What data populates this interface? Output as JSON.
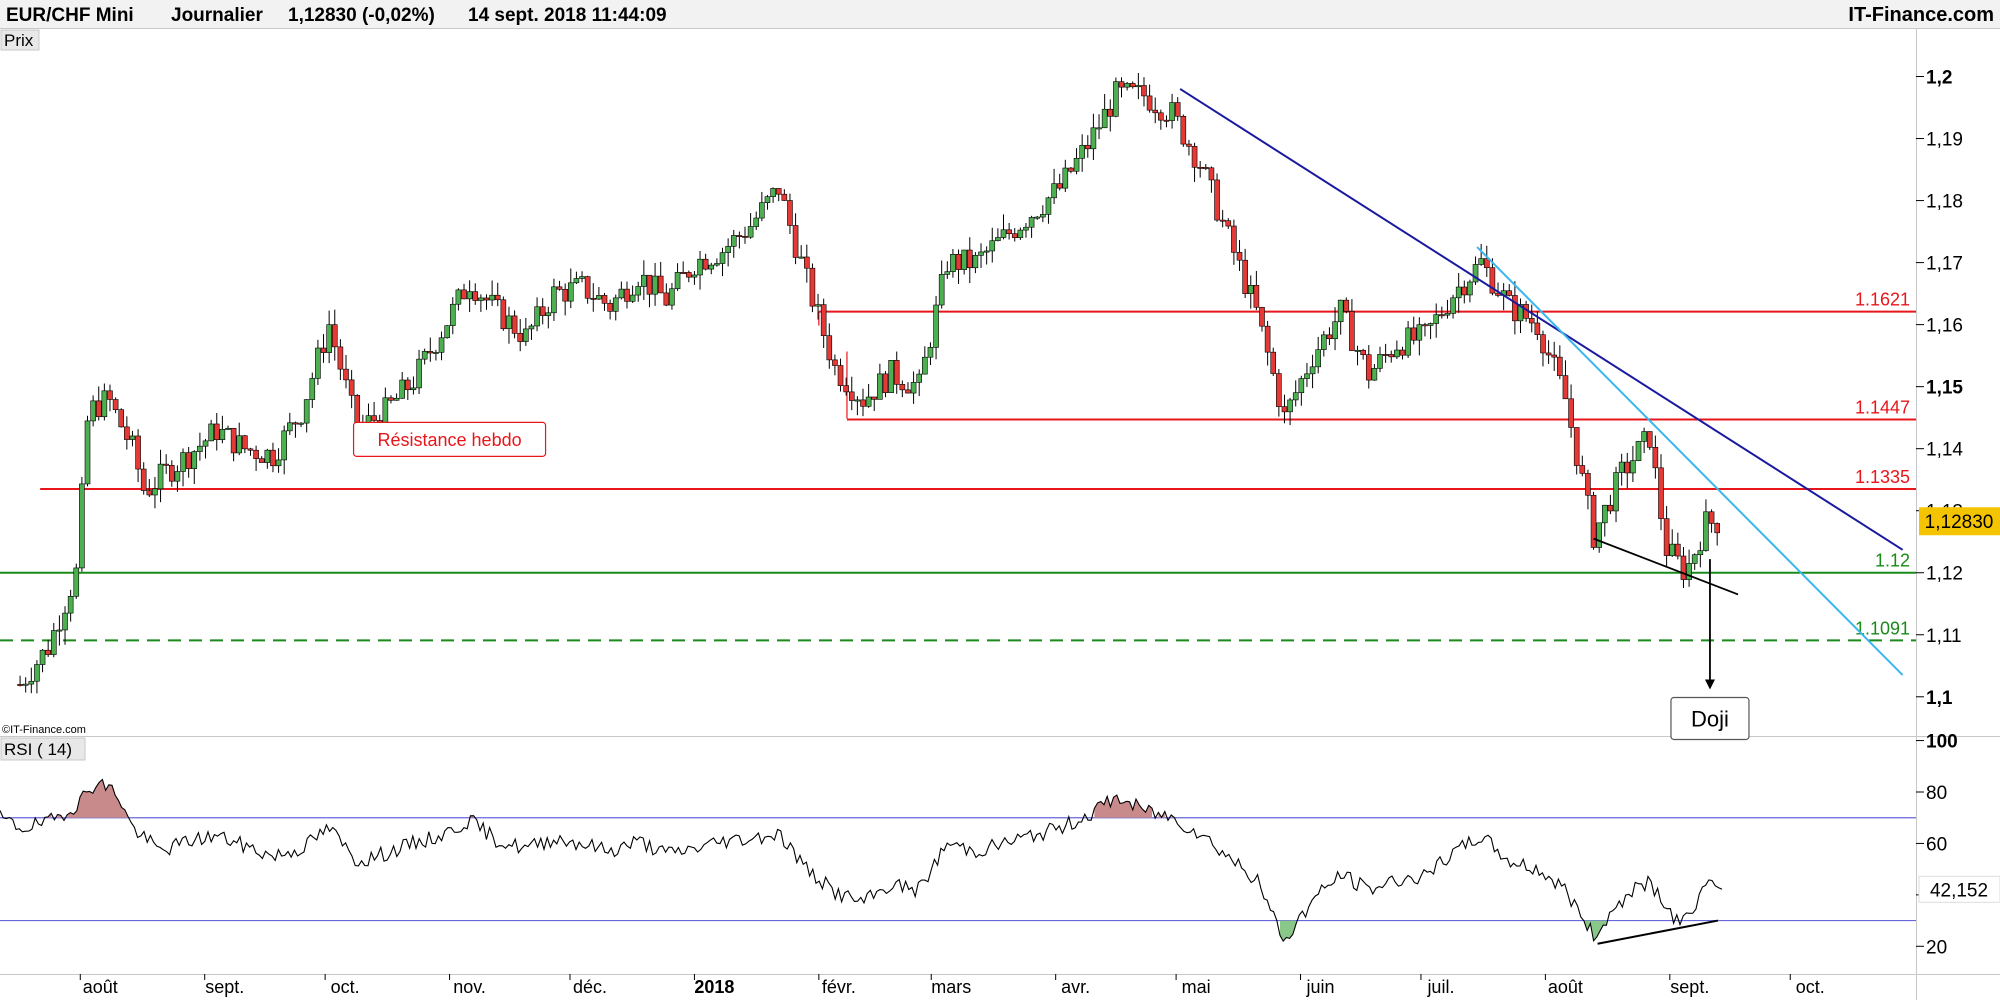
{
  "header": {
    "symbol": "EUR/CHF Mini",
    "period": "Journalier",
    "price_info": "1,12830 (-0,02%)",
    "datetime": "14 sept. 2018 11:44:09",
    "brand": "IT-Finance.com"
  },
  "price_panel_label": "Prix",
  "copyright": "©IT-Finance.com",
  "rsi_panel_label": "RSI ( 14)",
  "colors": {
    "up_candle": "#4caf50",
    "down_candle": "#e53935",
    "resistance": "#e8161b",
    "support": "#1a8a1a",
    "trend_dark": "#1a1a9e",
    "trend_light": "#3ab7ee",
    "current_price_bg": "#f5c400",
    "rsi_band": "#6666dd",
    "rsi_overbought_fill": "#c88a8a",
    "rsi_oversold_fill": "#8ac88a"
  },
  "chart_data": [
    {
      "type": "candlestick",
      "title": "EUR/CHF Mini",
      "x_labels": [
        "août",
        "sept.",
        "oct.",
        "nov.",
        "déc.",
        "2018",
        "févr.",
        "mars",
        "avr.",
        "mai",
        "juin",
        "juil.",
        "août",
        "sept.",
        "oct."
      ],
      "y_ticks": [
        "1,1",
        "1,11",
        "1,12",
        "1,13",
        "1,14",
        "1,15",
        "1,16",
        "1,17",
        "1,18",
        "1,19",
        "1,2"
      ],
      "y_range": [
        1.094,
        1.2075
      ],
      "current_price": "1,12830",
      "close_path": [
        [
          "2017-07-17",
          1.102
        ],
        [
          "2017-07-24",
          1.108
        ],
        [
          "2017-07-31",
          1.12
        ],
        [
          "2017-08-03",
          1.146
        ],
        [
          "2017-08-08",
          1.148
        ],
        [
          "2017-08-14",
          1.14
        ],
        [
          "2017-08-17",
          1.133
        ],
        [
          "2017-08-22",
          1.136
        ],
        [
          "2017-08-28",
          1.139
        ],
        [
          "2017-09-04",
          1.143
        ],
        [
          "2017-09-11",
          1.14
        ],
        [
          "2017-09-18",
          1.139
        ],
        [
          "2017-09-25",
          1.146
        ],
        [
          "2017-10-02",
          1.16
        ],
        [
          "2017-10-09",
          1.143
        ],
        [
          "2017-10-16",
          1.146
        ],
        [
          "2017-10-23",
          1.151
        ],
        [
          "2017-10-30",
          1.159
        ],
        [
          "2017-11-06",
          1.167
        ],
        [
          "2017-11-13",
          1.162
        ],
        [
          "2017-11-20",
          1.158
        ],
        [
          "2017-11-27",
          1.165
        ],
        [
          "2017-12-04",
          1.166
        ],
        [
          "2017-12-11",
          1.163
        ],
        [
          "2017-12-18",
          1.168
        ],
        [
          "2017-12-25",
          1.164
        ],
        [
          "2018-01-01",
          1.17
        ],
        [
          "2018-01-08",
          1.172
        ],
        [
          "2018-01-15",
          1.176
        ],
        [
          "2018-01-22",
          1.182
        ],
        [
          "2018-01-29",
          1.167
        ],
        [
          "2018-02-05",
          1.153
        ],
        [
          "2018-02-12",
          1.148
        ],
        [
          "2018-02-19",
          1.152
        ],
        [
          "2018-02-26",
          1.15
        ],
        [
          "2018-03-05",
          1.17
        ],
        [
          "2018-03-12",
          1.17
        ],
        [
          "2018-03-19",
          1.174
        ],
        [
          "2018-03-26",
          1.178
        ],
        [
          "2018-04-02",
          1.182
        ],
        [
          "2018-04-09",
          1.189
        ],
        [
          "2018-04-16",
          1.197
        ],
        [
          "2018-04-23",
          1.197
        ],
        [
          "2018-04-30",
          1.194
        ],
        [
          "2018-05-07",
          1.186
        ],
        [
          "2018-05-14",
          1.174
        ],
        [
          "2018-05-21",
          1.162
        ],
        [
          "2018-05-28",
          1.145
        ],
        [
          "2018-06-04",
          1.155
        ],
        [
          "2018-06-11",
          1.162
        ],
        [
          "2018-06-18",
          1.152
        ],
        [
          "2018-06-25",
          1.157
        ],
        [
          "2018-07-02",
          1.158
        ],
        [
          "2018-07-09",
          1.165
        ],
        [
          "2018-07-16",
          1.17
        ],
        [
          "2018-07-23",
          1.163
        ],
        [
          "2018-07-30",
          1.16
        ],
        [
          "2018-08-06",
          1.148
        ],
        [
          "2018-08-13",
          1.126
        ],
        [
          "2018-08-20",
          1.136
        ],
        [
          "2018-08-27",
          1.142
        ],
        [
          "2018-08-31",
          1.124
        ],
        [
          "2018-09-05",
          1.12
        ],
        [
          "2018-09-10",
          1.128
        ],
        [
          "2018-09-14",
          1.1283
        ]
      ],
      "levels": [
        {
          "label": "1.1621",
          "value": 1.1621,
          "style": "resistance",
          "start": "2018-02-01"
        },
        {
          "label": "1.1447",
          "value": 1.1447,
          "style": "resistance",
          "start": "2018-02-08"
        },
        {
          "label": "1.1335",
          "value": 1.1335,
          "style": "resistance",
          "start": "2017-07-22"
        },
        {
          "label": "1.12",
          "value": 1.12,
          "style": "support",
          "start": "2017-07-12"
        },
        {
          "label": "1.1091",
          "value": 1.1091,
          "style": "support-dashed",
          "start": "2017-07-12"
        }
      ],
      "trendlines": [
        {
          "style": "dark",
          "from": [
            "2018-05-02",
            1.198
          ],
          "to": [
            "2018-10-29",
            1.1237
          ]
        },
        {
          "style": "light",
          "from": [
            "2018-07-15",
            1.1725
          ],
          "to": [
            "2018-10-29",
            1.1035
          ]
        },
        {
          "style": "black",
          "from": [
            "2018-08-13",
            1.1255
          ],
          "to": [
            "2018-09-18",
            1.1165
          ]
        }
      ],
      "arrow": {
        "date": "2018-09-11",
        "from": 1.1222,
        "to": 1.1015
      },
      "annotations": [
        {
          "text": "Résistance hebdo",
          "date": "2017-11-01",
          "value": 1.1415,
          "color": "#e8161b"
        },
        {
          "text": "Doji",
          "date": "2018-09-11",
          "value": 1.0965,
          "color": "#000000"
        }
      ]
    },
    {
      "type": "line",
      "title": "RSI ( 14)",
      "y_ticks": [
        "20",
        "40",
        "60",
        "80",
        "100"
      ],
      "y_range": [
        10,
        101
      ],
      "bands": [
        30,
        70
      ],
      "current_value": "42,152",
      "series": [
        [
          "2017-07-12",
          70
        ],
        [
          "2017-07-17",
          66
        ],
        [
          "2017-07-24",
          68
        ],
        [
          "2017-07-31",
          75
        ],
        [
          "2017-08-05",
          84
        ],
        [
          "2017-08-10",
          80
        ],
        [
          "2017-08-14",
          66
        ],
        [
          "2017-08-21",
          57
        ],
        [
          "2017-08-28",
          61
        ],
        [
          "2017-09-04",
          63
        ],
        [
          "2017-09-11",
          59
        ],
        [
          "2017-09-18",
          55
        ],
        [
          "2017-09-25",
          58
        ],
        [
          "2017-10-02",
          66
        ],
        [
          "2017-10-09",
          53
        ],
        [
          "2017-10-16",
          56
        ],
        [
          "2017-10-23",
          60
        ],
        [
          "2017-10-30",
          63
        ],
        [
          "2017-11-06",
          69
        ],
        [
          "2017-11-13",
          61
        ],
        [
          "2017-11-20",
          58
        ],
        [
          "2017-11-27",
          62
        ],
        [
          "2017-12-04",
          60
        ],
        [
          "2017-12-11",
          57
        ],
        [
          "2017-12-18",
          61
        ],
        [
          "2017-12-25",
          56
        ],
        [
          "2018-01-01",
          58
        ],
        [
          "2018-01-08",
          61
        ],
        [
          "2018-01-15",
          62
        ],
        [
          "2018-01-22",
          64
        ],
        [
          "2018-01-29",
          50
        ],
        [
          "2018-02-05",
          41
        ],
        [
          "2018-02-12",
          37
        ],
        [
          "2018-02-19",
          44
        ],
        [
          "2018-02-26",
          42
        ],
        [
          "2018-03-05",
          60
        ],
        [
          "2018-03-12",
          57
        ],
        [
          "2018-03-19",
          60
        ],
        [
          "2018-03-26",
          63
        ],
        [
          "2018-04-02",
          66
        ],
        [
          "2018-04-09",
          71
        ],
        [
          "2018-04-16",
          78
        ],
        [
          "2018-04-23",
          73
        ],
        [
          "2018-04-30",
          70
        ],
        [
          "2018-05-07",
          64
        ],
        [
          "2018-05-14",
          55
        ],
        [
          "2018-05-21",
          46
        ],
        [
          "2018-05-28",
          22
        ],
        [
          "2018-06-04",
          38
        ],
        [
          "2018-06-11",
          48
        ],
        [
          "2018-06-18",
          42
        ],
        [
          "2018-06-25",
          46
        ],
        [
          "2018-07-02",
          47
        ],
        [
          "2018-07-09",
          56
        ],
        [
          "2018-07-16",
          63
        ],
        [
          "2018-07-23",
          53
        ],
        [
          "2018-07-30",
          50
        ],
        [
          "2018-08-06",
          42
        ],
        [
          "2018-08-13",
          24
        ],
        [
          "2018-08-20",
          38
        ],
        [
          "2018-08-27",
          46
        ],
        [
          "2018-08-31",
          33
        ],
        [
          "2018-09-05",
          30
        ],
        [
          "2018-09-10",
          44
        ],
        [
          "2018-09-14",
          42.152
        ]
      ],
      "divergence_line": {
        "from": [
          "2018-08-14",
          21
        ],
        "to": [
          "2018-09-13",
          30
        ]
      }
    }
  ]
}
